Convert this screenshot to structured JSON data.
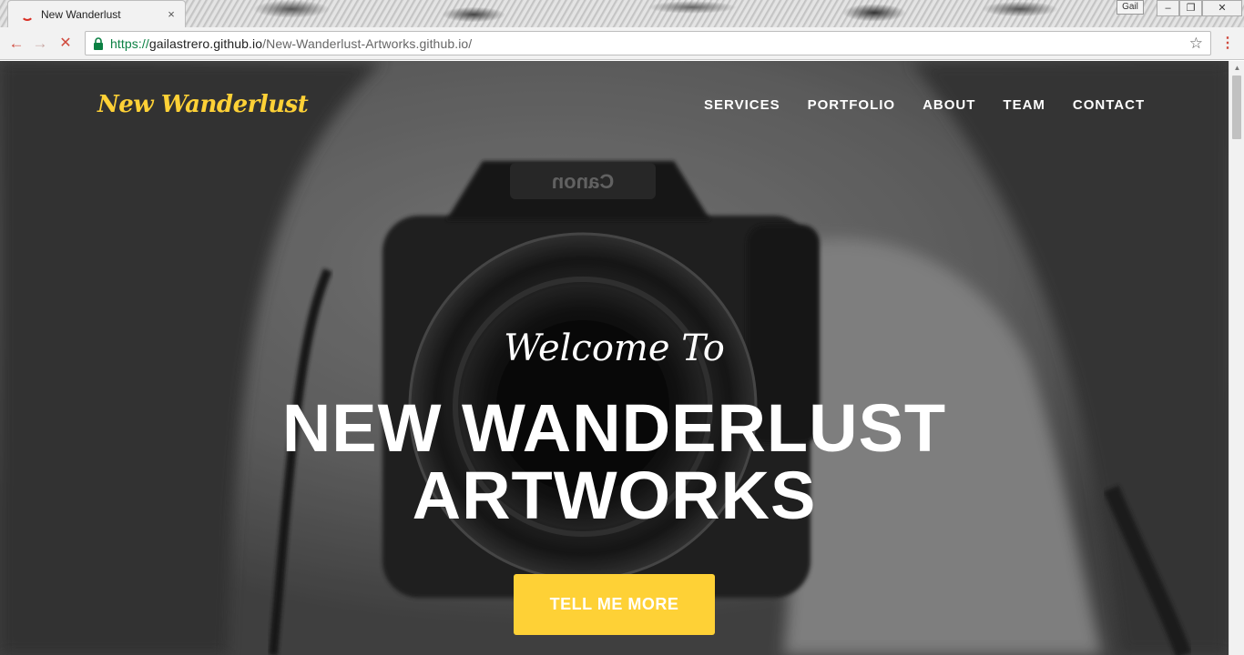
{
  "browser": {
    "tab_title": "New Wanderlust",
    "tab_close": "×",
    "user_name": "Gail",
    "window_controls": {
      "minimize": "‒",
      "maximize": "❐",
      "close": "✕"
    },
    "url_secure": "https://",
    "url_host": "gailastrero.github.io",
    "url_path": "/New-Wanderlust-Artworks.github.io/",
    "icons": {
      "back": "back-arrow-icon",
      "forward": "forward-arrow-icon",
      "stop": "stop-loading-icon",
      "lock": "lock-icon",
      "star": "bookmark-star-icon",
      "menu": "chrome-menu-icon"
    }
  },
  "site": {
    "brand": "New Wanderlust",
    "nav": [
      "SERVICES",
      "PORTFOLIO",
      "ABOUT",
      "TEAM",
      "CONTACT"
    ],
    "intro_lead": "Welcome To",
    "intro_heading_line1": "NEW WANDERLUST",
    "intro_heading_line2": "ARTWORKS",
    "cta_label": "TELL ME MORE"
  },
  "colors": {
    "accent": "#fed136",
    "nav_text": "#ffffff",
    "hero_overlay": "#6a6a6a",
    "browser_red": "#d04a3d",
    "secure_green": "#0b8043"
  }
}
